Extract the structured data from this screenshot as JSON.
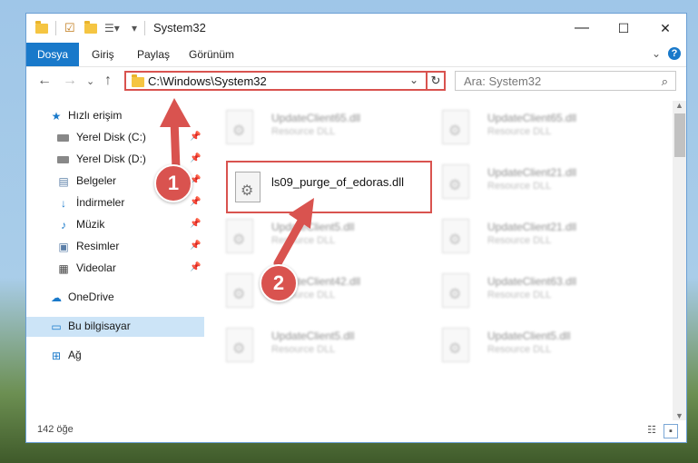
{
  "window": {
    "title": "System32",
    "controls": {
      "minimize": "—",
      "maximize": "☐",
      "close": "✕"
    }
  },
  "ribbon": {
    "tabs": [
      "Dosya",
      "Giriş",
      "Paylaş",
      "Görünüm"
    ],
    "help": "?"
  },
  "address": {
    "path": "C:\\Windows\\System32",
    "search_placeholder": "Ara: System32"
  },
  "sidebar": {
    "items": [
      {
        "label": "Hızlı erişim",
        "icon": "star-icon"
      },
      {
        "label": "Yerel Disk (C:)",
        "icon": "drive-icon",
        "pinned": true
      },
      {
        "label": "Yerel Disk (D:)",
        "icon": "drive-icon",
        "pinned": true
      },
      {
        "label": "Belgeler",
        "icon": "documents-icon",
        "pinned": true
      },
      {
        "label": "İndirmeler",
        "icon": "download-icon",
        "pinned": true
      },
      {
        "label": "Müzik",
        "icon": "music-icon",
        "pinned": true
      },
      {
        "label": "Resimler",
        "icon": "pictures-icon",
        "pinned": true
      },
      {
        "label": "Videolar",
        "icon": "video-icon",
        "pinned": true
      },
      {
        "label": "OneDrive",
        "icon": "cloud-icon"
      },
      {
        "label": "Bu bilgisayar",
        "icon": "computer-icon",
        "selected": true
      },
      {
        "label": "Ağ",
        "icon": "network-icon"
      }
    ]
  },
  "files": [
    {
      "name": "UpdateClient65.dll",
      "type": "Resource DLL"
    },
    {
      "name": "UpdateClient65.dll",
      "type": "Resource DLL"
    },
    {
      "name": "UpdateClient21.dll",
      "type": "Resource DLL"
    },
    {
      "name": "UpdateClient5.dll",
      "type": "Resource DLL"
    },
    {
      "name": "UpdateClient21.dll",
      "type": "Resource DLL"
    },
    {
      "name": "UpdateClient42.dll",
      "type": "Resource DLL"
    },
    {
      "name": "UpdateClient63.dll",
      "type": "Resource DLL"
    },
    {
      "name": "UpdateClient5.dll",
      "type": "Resource DLL"
    },
    {
      "name": "UpdateClient5.dll",
      "type": "Resource DLL"
    }
  ],
  "highlighted_file": {
    "name": "ls09_purge_of_edoras.dll"
  },
  "annotations": {
    "step1": "1",
    "step2": "2",
    "color": "#d9534f"
  },
  "status": {
    "count": "142 öğe"
  }
}
